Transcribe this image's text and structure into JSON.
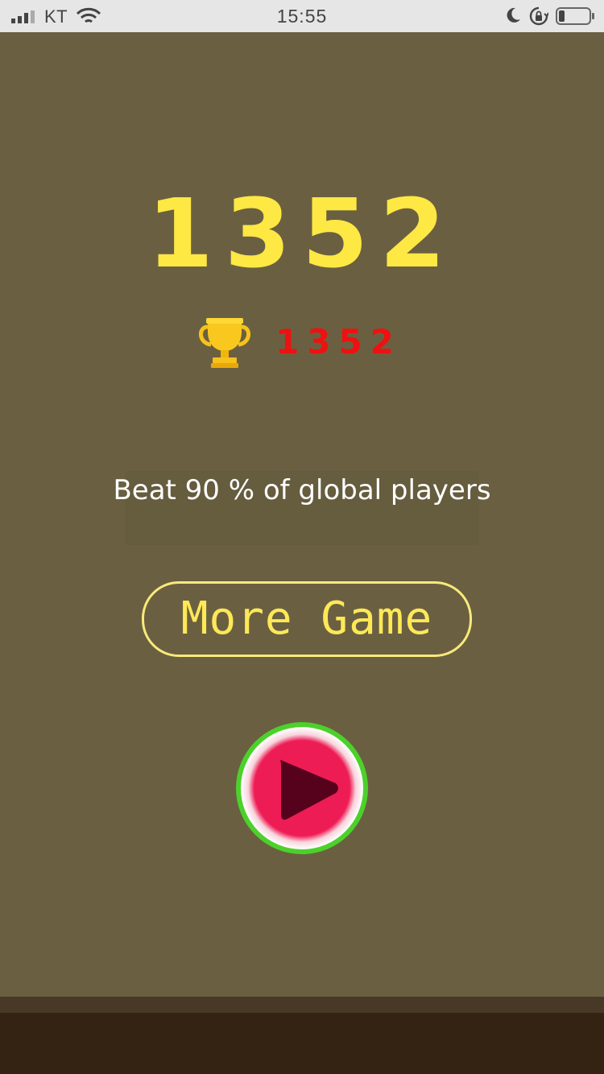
{
  "status_bar": {
    "carrier": "KT",
    "time": "15:55",
    "icons": [
      "signal-icon",
      "wifi-icon",
      "moon-icon",
      "rotation-lock-icon",
      "battery-icon"
    ]
  },
  "game": {
    "score": "1352",
    "best_score": "1352",
    "beat_text": "Beat 90 % of global players",
    "more_game_label": "More Game",
    "play_icon": "play-icon",
    "trophy_icon": "trophy-icon"
  },
  "colors": {
    "background": "#6a6041",
    "score": "#fee844",
    "best_score": "#ee1111",
    "button_border": "#fbe97a",
    "play_fill": "#ee1c55",
    "play_ring": "#4cd12a",
    "ground": "#342313"
  }
}
